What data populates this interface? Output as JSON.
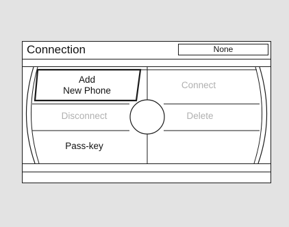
{
  "header": {
    "title": "Connection",
    "status": "None"
  },
  "menu": {
    "add_new_phone": {
      "line1": "Add",
      "line2": "New Phone",
      "enabled": true,
      "selected": true
    },
    "connect": {
      "label": "Connect",
      "enabled": false
    },
    "disconnect": {
      "label": "Disconnect",
      "enabled": false
    },
    "delete": {
      "label": "Delete",
      "enabled": false
    },
    "pass_key": {
      "label": "Pass-key",
      "enabled": true
    }
  },
  "colors": {
    "background": "#e3e3e3",
    "screen": "#ffffff",
    "line": "#1a1a1a",
    "disabled_text": "#b0b0b0"
  },
  "icons": {
    "center_knob": "circle-knob-icon"
  }
}
